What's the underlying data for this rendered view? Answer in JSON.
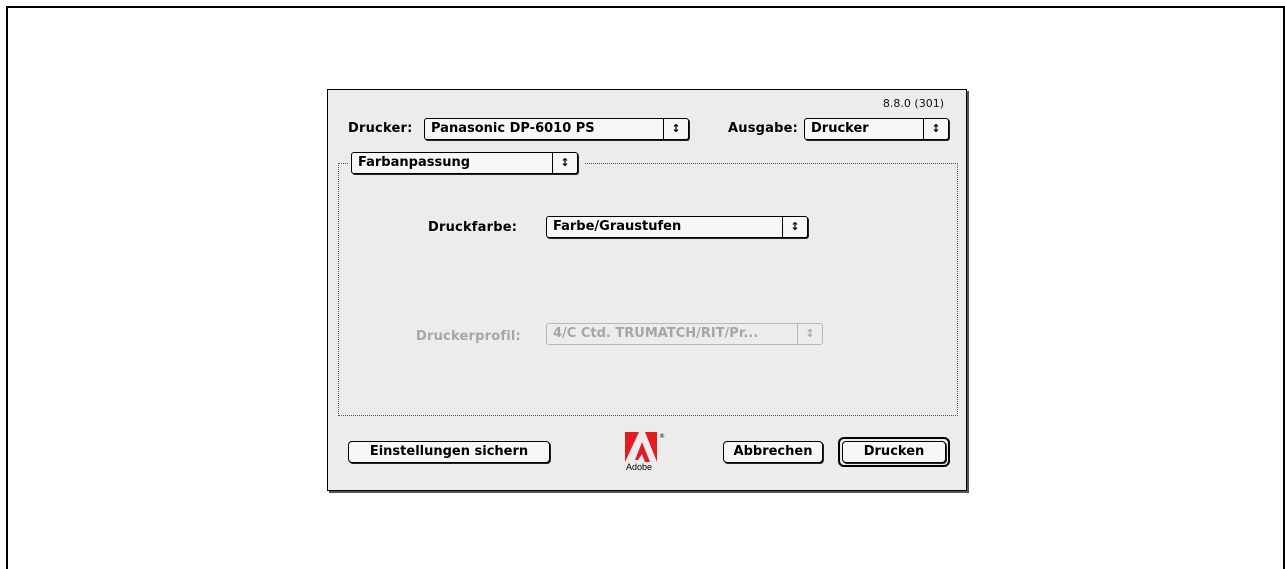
{
  "dialog": {
    "version": "8.8.0 (301)",
    "printer": {
      "label": "Drucker:",
      "value": "Panasonic DP-6010 PS"
    },
    "output": {
      "label": "Ausgabe:",
      "value": "Drucker"
    },
    "panel_menu": {
      "value": "Farbanpassung"
    },
    "print_color": {
      "label": "Druckfarbe:",
      "value": "Farbe/Graustufen"
    },
    "printer_profile": {
      "label": "Druckerprofil:",
      "value": "4/C Ctd. TRUMATCH/RIT/Pr...",
      "enabled": false
    },
    "buttons": {
      "save_settings": "Einstellungen sichern",
      "cancel": "Abbrechen",
      "print": "Drucken"
    },
    "logo_text": "Adobe",
    "colors": {
      "adobe_red": "#e31b23",
      "dialog_bg": "#ececec"
    }
  }
}
